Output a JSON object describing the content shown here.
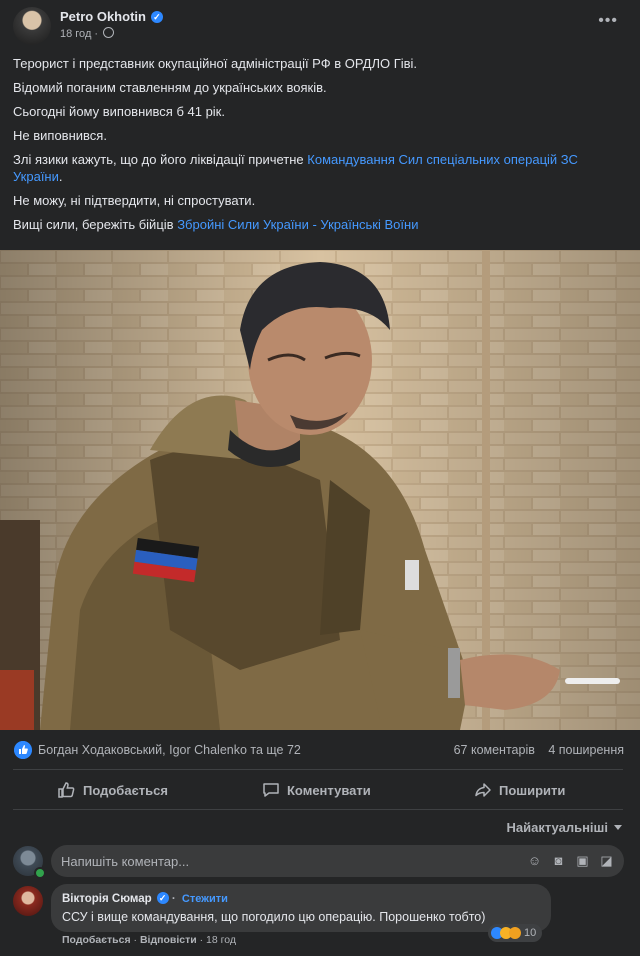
{
  "post": {
    "author": "Petro Okhotin",
    "time": "18 год",
    "paragraphs": {
      "p1": "Терорист і представник окупаційної адміністрації РФ в ОРДЛО Гіві.",
      "p2": "Відомий поганим ставленням до українських вояків.",
      "p3": "Сьогодні йому виповнився б 41 рік.",
      "p4": "Не виповнився.",
      "p5_text": "Злі язики кажуть, що до його ліквідації причетне ",
      "p5_link": "Командування Сил спеціальних операцій ЗС України",
      "p5_end": ".",
      "p6": "Не можу, ні підтвердити, ні спростувати.",
      "p7_text": "Вищі сили, бережіть бійців ",
      "p7_link": "Збройні Сили України - Українські Воїни"
    }
  },
  "reactions": {
    "summary": "Богдан Ходаковський, Igor Chalenko та ще 72",
    "comments_count": "67 коментарів",
    "shares_count": "4 поширення"
  },
  "actions": {
    "like": "Подобається",
    "comment": "Коментувати",
    "share": "Поширити"
  },
  "sort": {
    "label": "Найактуальніші"
  },
  "composer": {
    "placeholder": "Напишіть коментар..."
  },
  "comment": {
    "author": "Вікторія Сюмар",
    "follow": "Стежити",
    "text": "ССУ і вище командування, що погодило цю операцію. Порошенко тобто)",
    "like": "Подобається",
    "reply": "Відповісти",
    "time": "18 год",
    "reaction_count": "10"
  },
  "colors": {
    "background": "#242526",
    "bubble": "#3a3b3c",
    "link": "#4599ff",
    "like_blue": "#2d88ff"
  }
}
